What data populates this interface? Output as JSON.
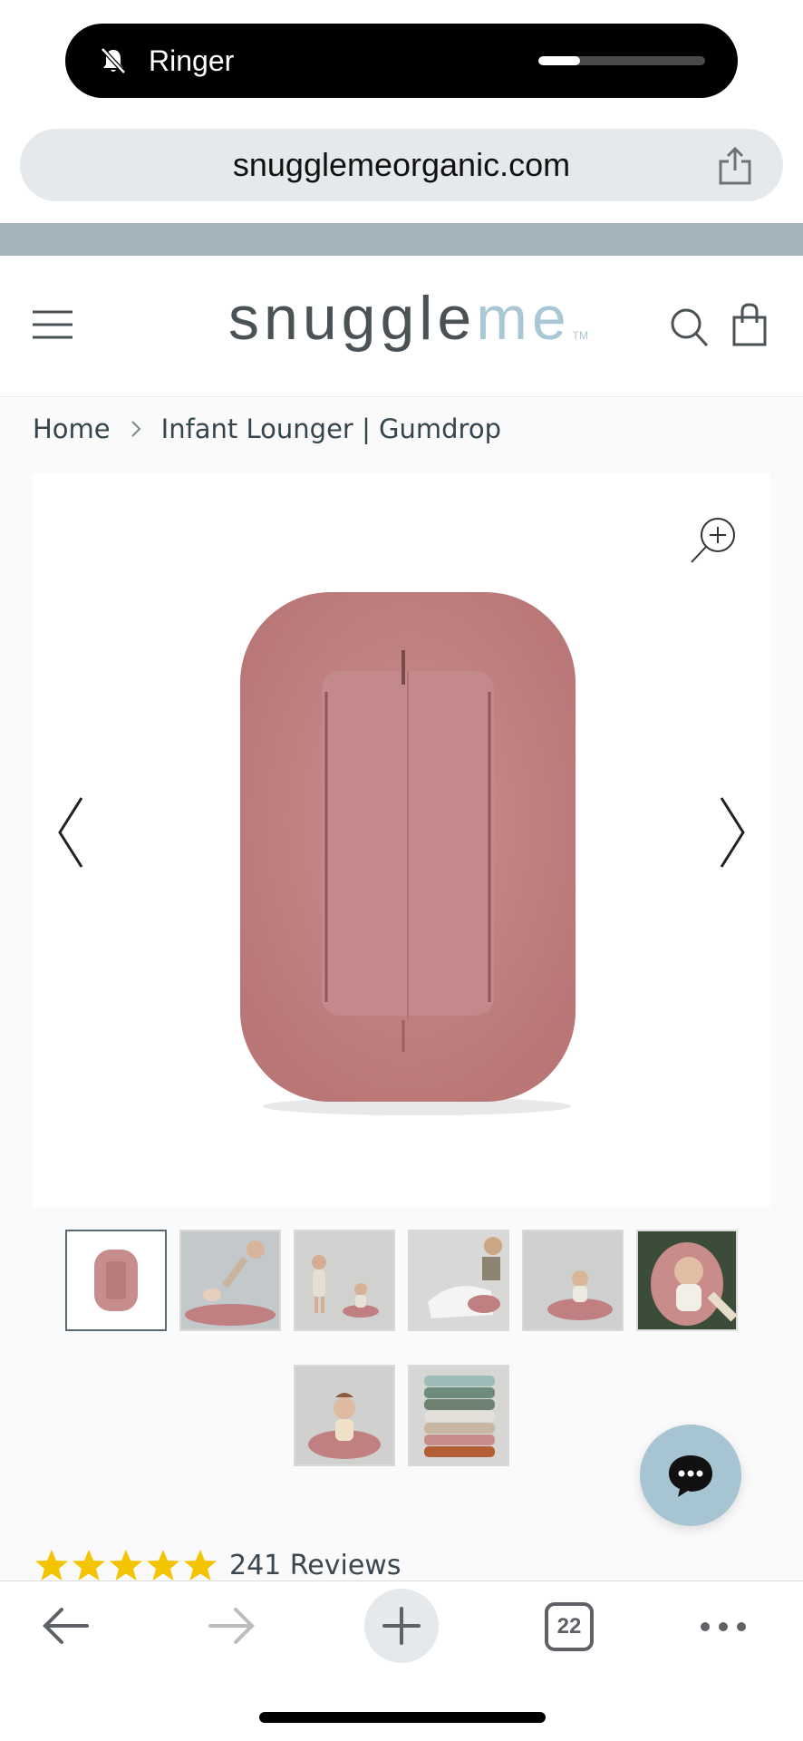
{
  "status": {
    "ringer_label": "Ringer",
    "ringer_icon": "bell-slash-icon",
    "volume_level": 0.25
  },
  "browser": {
    "url": "snugglemeorganic.com",
    "share_icon": "share-icon",
    "toolbar": {
      "back_icon": "back-arrow-icon",
      "forward_icon": "forward-arrow-icon",
      "new_tab_icon": "plus-icon",
      "tab_count": "22",
      "more_icon": "more-dots-icon"
    }
  },
  "header": {
    "logo_part1": "snuggle",
    "logo_part2": "me",
    "logo_tm": "TM",
    "menu_icon": "hamburger-menu-icon",
    "search_icon": "search-icon",
    "cart_icon": "shopping-bag-icon"
  },
  "breadcrumb": {
    "home": "Home",
    "current": "Infant Lounger | Gumdrop"
  },
  "product": {
    "color_swatch": "#c88a89",
    "thumbnail_count": 8,
    "selected_thumbnail": 1,
    "rating": 5,
    "reviews_label": "241 Reviews"
  },
  "colors": {
    "brand_blue": "#a9c7d5",
    "brand_grey": "#4a5256",
    "star_yellow": "#f4c400"
  }
}
